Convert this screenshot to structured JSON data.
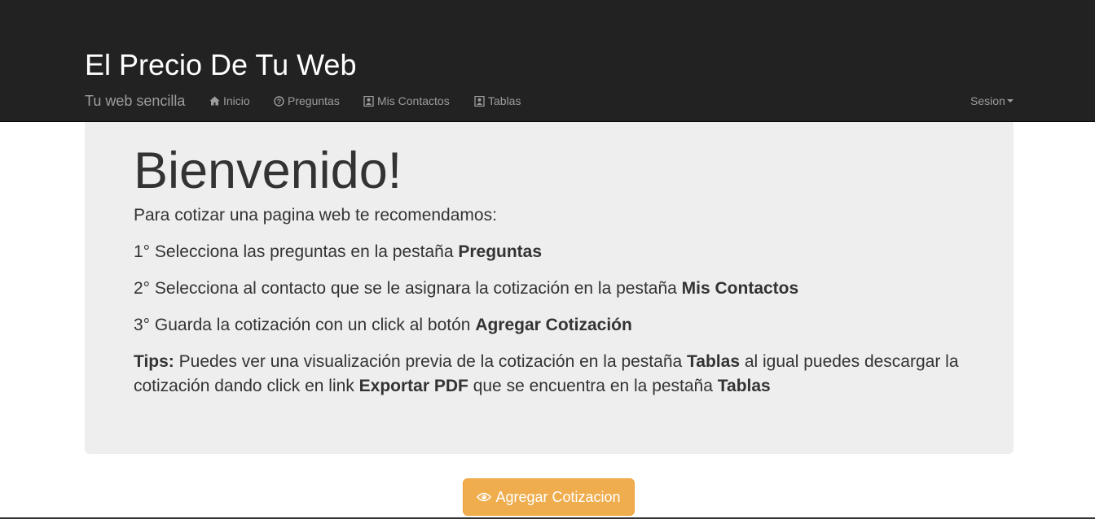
{
  "navbar": {
    "title": "El Precio De Tu Web",
    "subtitle": "Tu web sencilla",
    "items": [
      {
        "label": "Inicio",
        "icon": "home-icon"
      },
      {
        "label": "Preguntas",
        "icon": "question-circle-icon"
      },
      {
        "label": "Mis Contactos",
        "icon": "contact-card-icon"
      },
      {
        "label": "Tablas",
        "icon": "contact-card-icon"
      }
    ],
    "session": {
      "label": "Sesion",
      "icon": "caret-down-icon"
    }
  },
  "jumbotron": {
    "heading": "Bienvenido!",
    "intro": "Para cotizar una pagina web te recomendamos:",
    "step1": {
      "text": "1° Selecciona las preguntas en la pestaña ",
      "bold": "Preguntas"
    },
    "step2": {
      "text": "2° Selecciona al contacto que se le asignara la cotización en la pestaña ",
      "bold": "Mis Contactos"
    },
    "step3": {
      "text": "3° Guarda la cotización con un click al botón ",
      "bold": "Agregar Cotización"
    },
    "tips": {
      "label": "Tips:",
      "t1": " Puedes ver una visualización previa de la cotización en la pestaña ",
      "b1": "Tablas",
      "t2": " al igual puedes descargar la cotización dando click en link ",
      "b2": "Exportar PDF",
      "t3": " que se encuentra en la pestaña ",
      "b3": "Tablas"
    }
  },
  "action_button": {
    "label": "Agregar Cotizacion",
    "icon": "eye-icon"
  },
  "colors": {
    "navbar_bg": "#222222",
    "jumbotron_bg": "#eeeeee",
    "button_warning": "#f0ad4e"
  }
}
